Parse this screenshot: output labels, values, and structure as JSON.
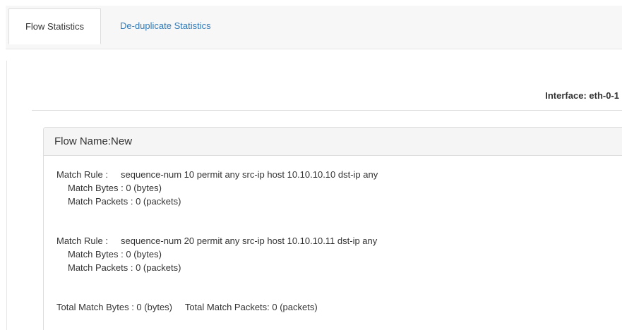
{
  "tabs": [
    {
      "label": "Flow Statistics",
      "active": true
    },
    {
      "label": "De-duplicate Statistics",
      "active": false
    }
  ],
  "interface_label": "Interface: eth-0-1",
  "panel": {
    "title": "Flow Name:New",
    "rules": [
      {
        "rule_line": "Match Rule :     sequence-num 10 permit any src-ip host 10.10.10.10 dst-ip any",
        "bytes_line": "Match Bytes : 0 (bytes)",
        "packets_line": "Match Packets : 0 (packets)"
      },
      {
        "rule_line": "Match Rule :     sequence-num 20 permit any src-ip host 10.10.10.11 dst-ip any",
        "bytes_line": "Match Bytes : 0 (bytes)",
        "packets_line": "Match Packets : 0 (packets)"
      }
    ],
    "totals_line": "Total Match Bytes : 0 (bytes)     Total Match Packets: 0 (packets)"
  },
  "colors": {
    "link": "#337ab7",
    "text": "#333333",
    "panel_heading_bg": "#f5f5f5",
    "tabbar_bg": "#f7f7f7"
  }
}
